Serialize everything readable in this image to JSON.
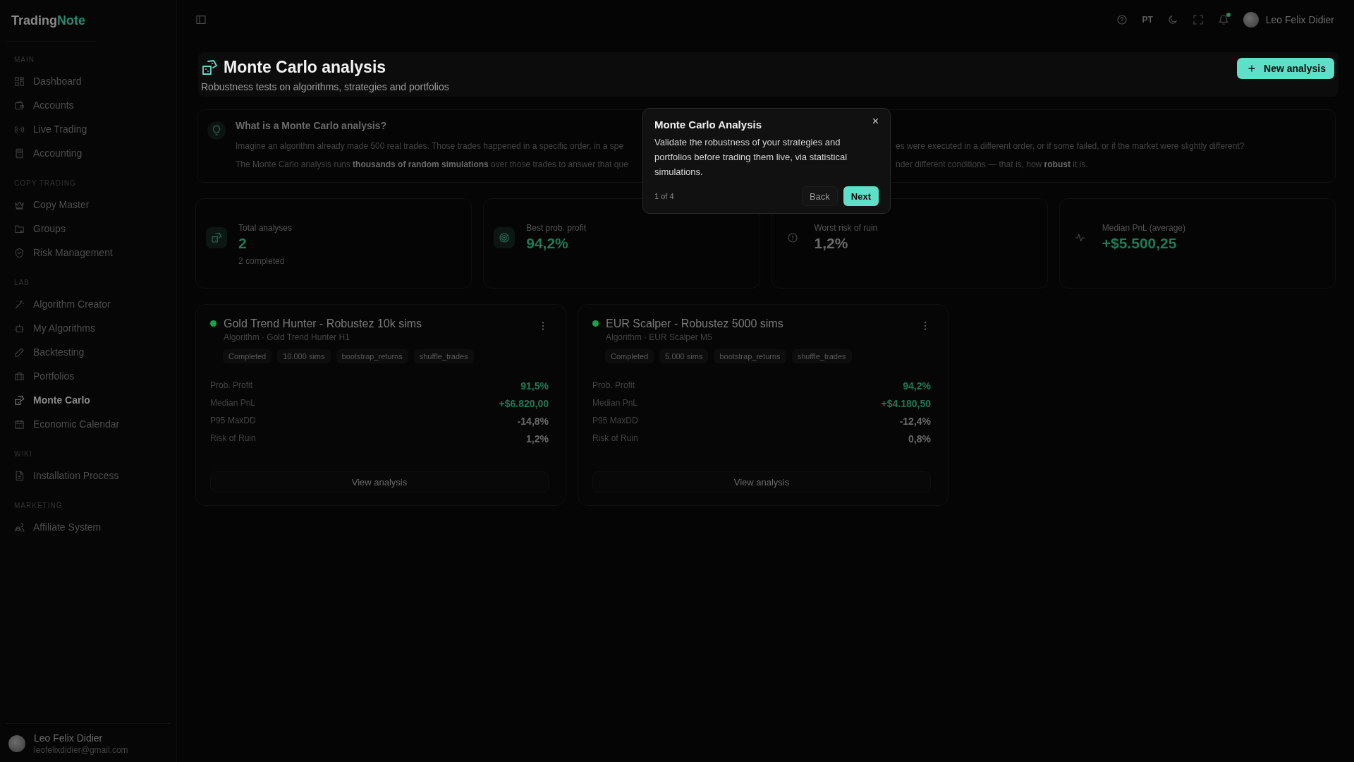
{
  "brand": {
    "prefix": "Trading",
    "suffix": "Note"
  },
  "sidebar": {
    "sections": [
      {
        "title": "MAIN",
        "items": [
          {
            "label": "Dashboard",
            "selected": false
          },
          {
            "label": "Accounts",
            "selected": false
          },
          {
            "label": "Live Trading",
            "selected": false
          },
          {
            "label": "Accounting",
            "selected": false
          }
        ]
      },
      {
        "title": "COPY TRADING",
        "items": [
          {
            "label": "Copy Master",
            "selected": false
          },
          {
            "label": "Groups",
            "selected": false
          },
          {
            "label": "Risk Management",
            "selected": false
          }
        ]
      },
      {
        "title": "LAB",
        "items": [
          {
            "label": "Algorithm Creator",
            "selected": false
          },
          {
            "label": "My Algorithms",
            "selected": false
          },
          {
            "label": "Backtesting",
            "selected": false
          },
          {
            "label": "Portfolios",
            "selected": false
          },
          {
            "label": "Monte Carlo",
            "selected": true
          },
          {
            "label": "Economic Calendar",
            "selected": false
          }
        ]
      },
      {
        "title": "WIKI",
        "items": [
          {
            "label": "Installation Process",
            "selected": false
          }
        ]
      },
      {
        "title": "MARKETING",
        "items": [
          {
            "label": "Affiliate System",
            "selected": false
          }
        ]
      }
    ],
    "user": {
      "name": "Leo Felix Didier",
      "email": "leofelixdidier@gmail.com"
    }
  },
  "topbar": {
    "language": "PT",
    "user_name": "Leo Felix Didier",
    "notification_dot": true
  },
  "page": {
    "title": "Monte Carlo analysis",
    "subtitle": "Robustness tests on algorithms, strategies and portfolios",
    "new_button": "New analysis"
  },
  "info": {
    "title": "What is a Monte Carlo analysis?",
    "lines": [
      {
        "left": "Imagine an algorithm already made 500 real trades. Those trades happened in a specific order, in a spe",
        "right": "es were executed in a different order, or if some failed, or if the market were slightly different?"
      },
      {
        "left": "The Monte Carlo analysis runs **thousands of random simulations** over those trades to answer that que",
        "right": "nder different conditions — that is, how **robust** it is."
      }
    ]
  },
  "tour": {
    "title": "Monte Carlo Analysis",
    "body": "Validate the robustness of your strategies and portfolios before trading them live, via statistical simulations.",
    "close": "×",
    "step": "1 of 4",
    "back": "Back",
    "next": "Next"
  },
  "stats": [
    {
      "label": "Total analyses",
      "value": "2",
      "sub": "2 completed",
      "positive": true
    },
    {
      "label": "Best prob. profit",
      "value": "94,2%",
      "positive": true
    },
    {
      "label": "Worst risk of ruin",
      "value": "1,2%",
      "positive": false
    },
    {
      "label": "Median PnL (average)",
      "value": "+$5.500,25",
      "positive": true
    }
  ],
  "analyses": [
    {
      "title": "Gold Trend Hunter - Robustez 10k sims",
      "color": "#16a34a",
      "subtitle": "Algorithm · Gold Trend Hunter H1",
      "tags": [
        "Completed",
        "10.000 sims",
        "bootstrap_returns",
        "shuffle_trades"
      ],
      "metrics": [
        {
          "label": "Prob. Profit",
          "value": "91,5%",
          "positive": true
        },
        {
          "label": "Median PnL",
          "value": "+$6.820,00",
          "positive": true
        },
        {
          "label": "P95 MaxDD",
          "value": "-14,8%",
          "positive": false
        },
        {
          "label": "Risk of Ruin",
          "value": "1,2%",
          "positive": false
        }
      ],
      "action": "View analysis"
    },
    {
      "title": "EUR Scalper - Robustez 5000 sims",
      "color": "#16a34a",
      "subtitle": "Algorithm · EUR Scalper M5",
      "tags": [
        "Completed",
        "5.000 sims",
        "bootstrap_returns",
        "shuffle_trades"
      ],
      "metrics": [
        {
          "label": "Prob. Profit",
          "value": "94,2%",
          "positive": true
        },
        {
          "label": "Median PnL",
          "value": "+$4.180,50",
          "positive": true
        },
        {
          "label": "P95 MaxDD",
          "value": "-12,4%",
          "positive": false
        },
        {
          "label": "Risk of Ruin",
          "value": "0,8%",
          "positive": false
        }
      ],
      "action": "View analysis"
    }
  ]
}
